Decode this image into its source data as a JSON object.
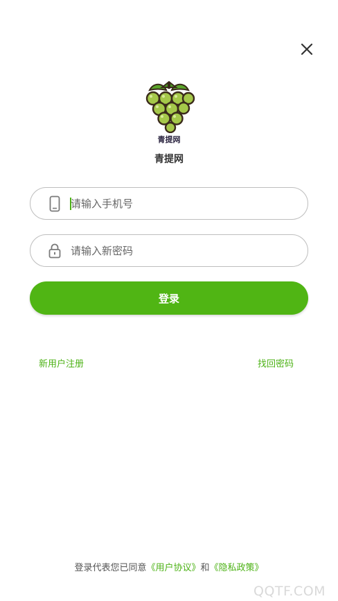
{
  "logo": {
    "text": "青提网"
  },
  "app_name": "青提网",
  "phone_field": {
    "placeholder": "请输入手机号"
  },
  "password_field": {
    "placeholder": "请输入新密码"
  },
  "login_button": "登录",
  "links": {
    "register": "新用户注册",
    "forgot": "找回密码"
  },
  "agreement": {
    "prefix": "登录代表您已同意",
    "user_agreement": "《用户协议》",
    "conjunction": "和",
    "privacy_policy": "《隐私政策》"
  },
  "watermark": "QQTF.COM",
  "colors": {
    "accent": "#50b514",
    "link": "#4cb215"
  },
  "icons": [
    "close-icon",
    "grape-logo",
    "phone-icon",
    "lock-icon"
  ]
}
